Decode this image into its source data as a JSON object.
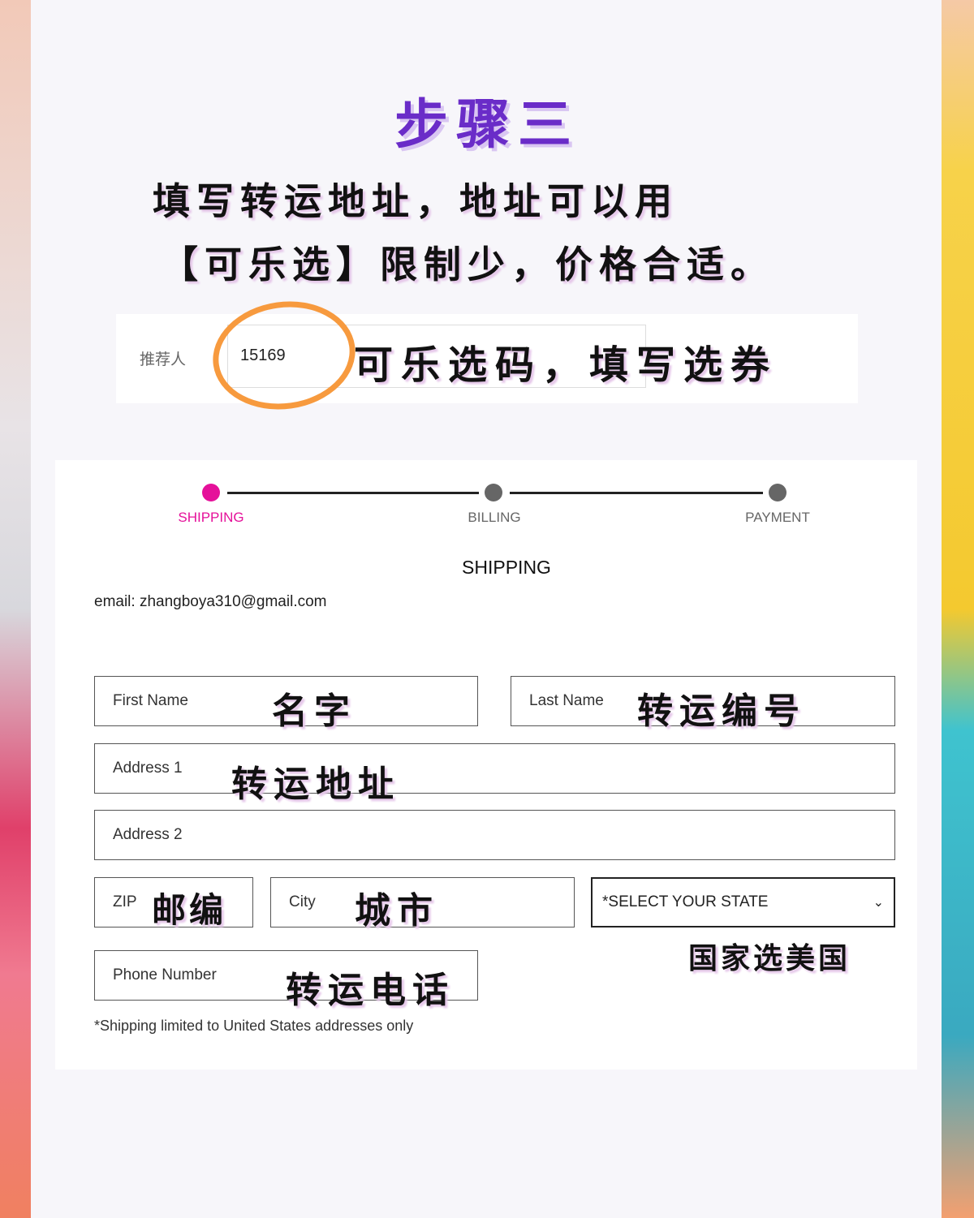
{
  "heading": "步骤三",
  "instructions": [
    "填写转运地址，地址可以用",
    "【可乐选】限制少，价格合适。"
  ],
  "referral": {
    "label": "推荐人",
    "value": "15169",
    "annotation": "可乐选码，填写选券"
  },
  "colors": {
    "accent": "#e5119a",
    "title": "#6a2cc8",
    "circle": "#f79a3e"
  },
  "steps": [
    {
      "label": "SHIPPING",
      "active": true
    },
    {
      "label": "BILLING",
      "active": false
    },
    {
      "label": "PAYMENT",
      "active": false
    }
  ],
  "form": {
    "heading": "SHIPPING",
    "email": "email: zhangboya310@gmail.com",
    "first_name": {
      "placeholder": "First Name",
      "annotation": "名字"
    },
    "last_name": {
      "placeholder": "Last Name",
      "annotation": "转运编号"
    },
    "address1": {
      "placeholder": "Address 1",
      "annotation": "转运地址"
    },
    "address2": {
      "placeholder": "Address 2"
    },
    "zip": {
      "placeholder": "ZIP",
      "annotation": "邮编"
    },
    "city": {
      "placeholder": "City",
      "annotation": "城市"
    },
    "state": {
      "selected": "*SELECT YOUR STATE",
      "annotation": "国家选美国"
    },
    "phone": {
      "placeholder": "Phone Number",
      "annotation": "转运电话"
    },
    "note": "*Shipping limited to United States addresses only"
  }
}
